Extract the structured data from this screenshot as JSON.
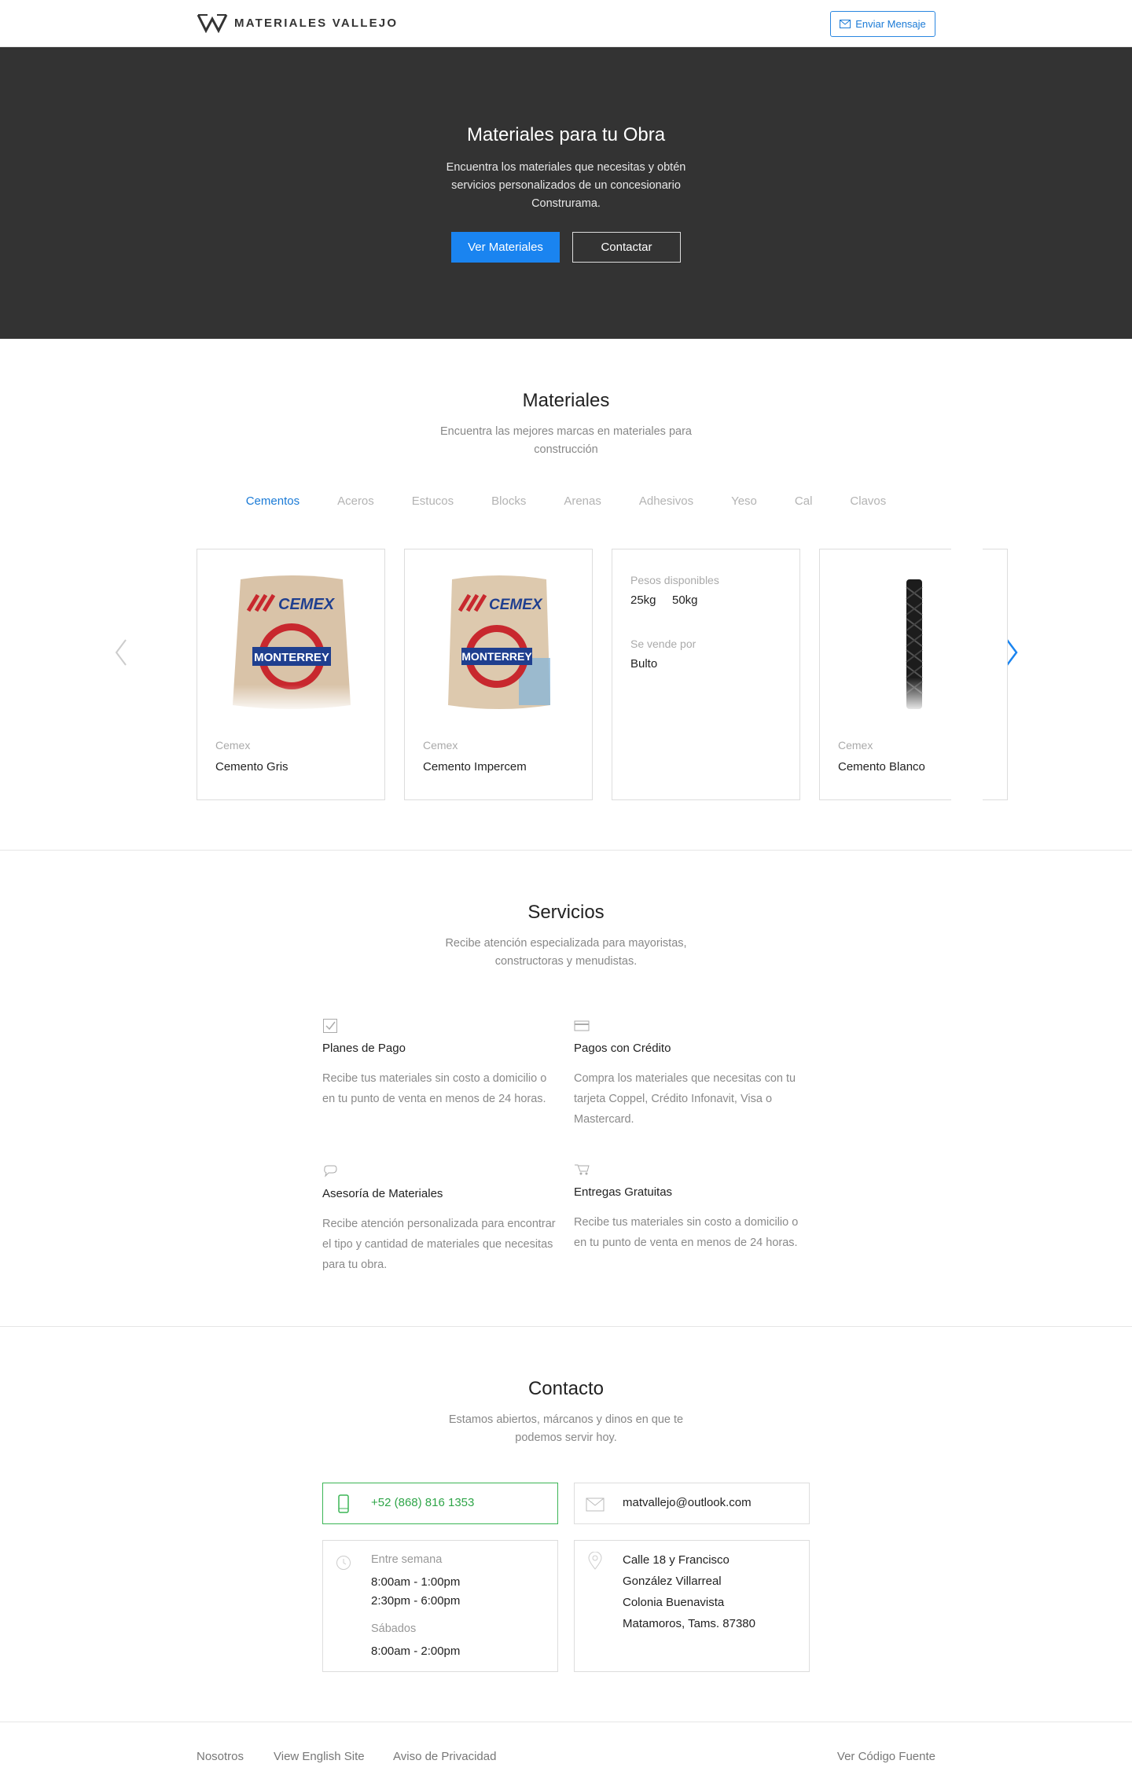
{
  "header": {
    "logo_text": "MATERIALES VALLEJO",
    "message_button": "Enviar Mensaje"
  },
  "hero": {
    "title": "Materiales para tu Obra",
    "subtitle": "Encuentra los materiales que necesitas y obtén servicios personalizados de un concesionario Construrama.",
    "primary_button": "Ver Materiales",
    "secondary_button": "Contactar"
  },
  "materiales": {
    "title": "Materiales",
    "subtitle": "Encuentra las mejores marcas en materiales para construcción",
    "tabs": [
      {
        "label": "Cementos",
        "active": true
      },
      {
        "label": "Aceros",
        "active": false
      },
      {
        "label": "Estucos",
        "active": false
      },
      {
        "label": "Blocks",
        "active": false
      },
      {
        "label": "Arenas",
        "active": false
      },
      {
        "label": "Adhesivos",
        "active": false
      },
      {
        "label": "Yeso",
        "active": false
      },
      {
        "label": "Cal",
        "active": false
      },
      {
        "label": "Clavos",
        "active": false
      }
    ],
    "cards": [
      {
        "brand": "Cemex",
        "name": "Cemento Gris",
        "image": "cement-bag-gray"
      },
      {
        "brand": "Cemex",
        "name": "Cemento Impercem",
        "image": "cement-bag-impercem"
      },
      {
        "weights_label": "Pesos disponibles",
        "weights": [
          "25kg",
          "50kg"
        ],
        "sold_label": "Se vende por",
        "sold_value": "Bulto"
      },
      {
        "brand": "Cemex",
        "name": "Cemento Blanco",
        "image": "steel-rebar"
      }
    ],
    "bag_brand": "CEMEX",
    "bag_label": "MONTERREY"
  },
  "servicios": {
    "title": "Servicios",
    "subtitle": "Recibe atención especializada para mayoristas, constructoras y menudistas.",
    "items": [
      {
        "icon": "checkbox-icon",
        "title": "Planes de Pago",
        "desc": "Recibe tus materiales sin costo a domicilio o en tu punto de venta en menos de 24 horas."
      },
      {
        "icon": "credit-card-icon",
        "title": "Pagos con Crédito",
        "desc": "Compra los materiales que necesitas con tu tarjeta Coppel, Crédito Infonavit, Visa o Mastercard."
      },
      {
        "icon": "chat-bubble-icon",
        "title": "Asesoría de Materiales",
        "desc": "Recibe atención personalizada para encontrar el tipo y cantidad de materiales que necesitas para tu obra."
      },
      {
        "icon": "delivery-cart-icon",
        "title": "Entregas Gratuitas",
        "desc": "Recibe tus materiales sin costo a domicilio o en tu punto de venta en menos de 24 horas."
      }
    ]
  },
  "contacto": {
    "title": "Contacto",
    "subtitle": "Estamos abiertos, márcanos y dinos en que te podemos servir hoy.",
    "phone": "+52 (868) 816 1353",
    "email": "matvallejo@outlook.com",
    "hours": {
      "weekday_label": "Entre semana",
      "weekday_1": "8:00am - 1:00pm",
      "weekday_2": "2:30pm - 6:00pm",
      "saturday_label": "Sábados",
      "saturday_1": "8:00am - 2:00pm"
    },
    "address": [
      "Calle 18 y Francisco",
      "González Villarreal",
      "Colonia Buenavista",
      "Matamoros, Tams. 87380"
    ]
  },
  "footer": {
    "links": [
      "Nosotros",
      "View English Site",
      "Aviso de Privacidad"
    ],
    "source_link": "Ver Código Fuente"
  },
  "colors": {
    "accent": "#1a84f0",
    "hero_bg": "#333333",
    "green": "#3bb555"
  }
}
